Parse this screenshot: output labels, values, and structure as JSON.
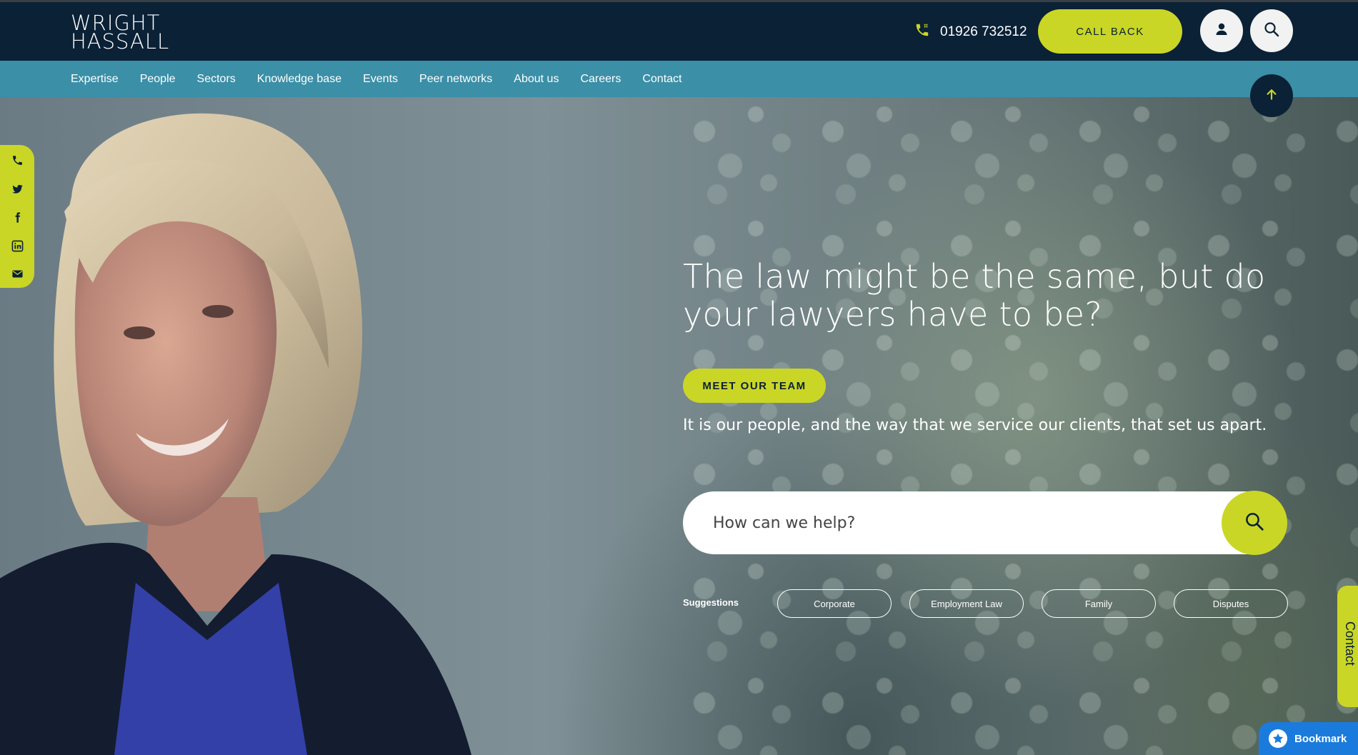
{
  "brand": {
    "logo_line1": "WRIGHT",
    "logo_line2": "HASSALL",
    "accent_color": "#cad626",
    "navy_color": "#0a2136",
    "nav_color": "#3b8fa7"
  },
  "header": {
    "phone_icon": "phone-icon",
    "phone_number": "01926 732512",
    "callback_label": "CALL BACK",
    "account_icon": "user-icon",
    "search_icon": "search-icon"
  },
  "nav": {
    "items": [
      {
        "label": "Expertise"
      },
      {
        "label": "People"
      },
      {
        "label": "Sectors"
      },
      {
        "label": "Knowledge base"
      },
      {
        "label": "Events"
      },
      {
        "label": "Peer networks"
      },
      {
        "label": "About us"
      },
      {
        "label": "Careers"
      },
      {
        "label": "Contact"
      }
    ]
  },
  "hero": {
    "headline": "The law might be the same, but do your lawyers have to be?",
    "cta_label": "MEET OUR TEAM",
    "tagline": "It is our people, and the way that we service our clients, that set us apart.",
    "search_placeholder": "How can we help?",
    "suggestions_label": "Suggestions",
    "suggestions": [
      "Corporate",
      "Employment Law",
      "Family",
      "Disputes"
    ]
  },
  "social": {
    "icons": [
      "phone-icon",
      "twitter-icon",
      "facebook-icon",
      "linkedin-icon",
      "email-icon"
    ]
  },
  "scroll_top_icon": "arrow-up-icon",
  "contact_tab_label": "Contact",
  "bookmark": {
    "label": "Bookmark",
    "icon": "star-icon"
  }
}
